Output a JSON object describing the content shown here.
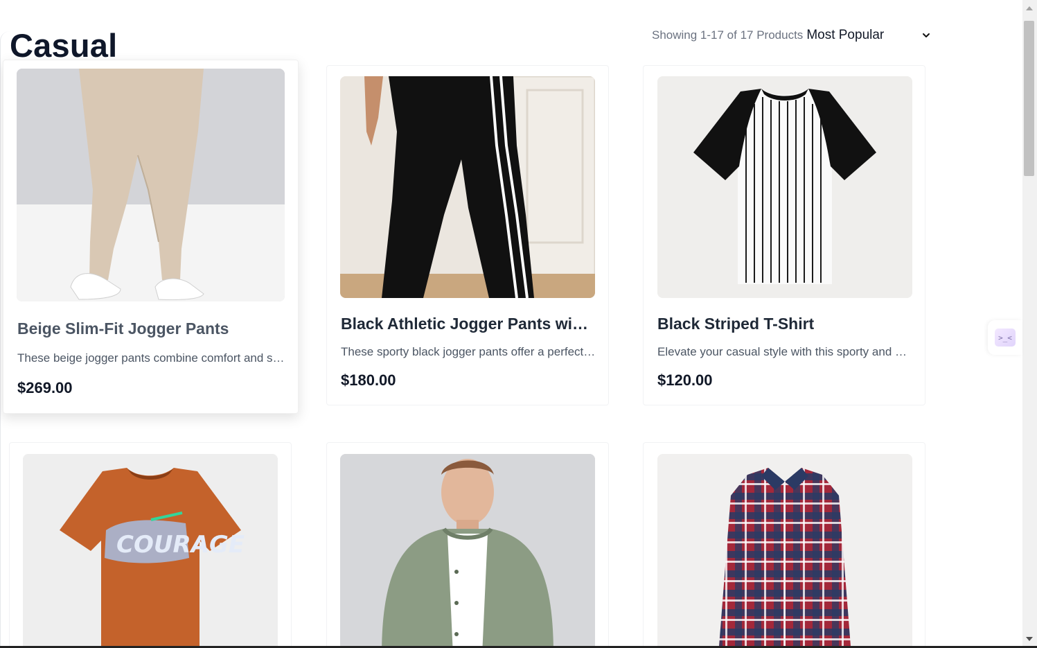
{
  "page": {
    "category_title": "Casual"
  },
  "toolbar": {
    "count_text": "Showing 1-17 of 17 Products",
    "sort_selected": "Most Popular"
  },
  "products": [
    {
      "name": "Beige Slim-Fit Jogger Pants",
      "description": "These beige jogger pants combine comfort and style",
      "price": "$269.00",
      "image": "beige-jogger-pants-photo"
    },
    {
      "name": "Black Athletic Jogger Pants with White Stripes",
      "description": "These sporty black jogger pants offer a perfect blend",
      "price": "$180.00",
      "image": "black-striped-jogger-pants-photo"
    },
    {
      "name": "Black Striped T-Shirt",
      "description": "Elevate your casual style with this sporty and classic",
      "price": "$120.00",
      "image": "black-striped-tshirt-photo"
    },
    {
      "name": "",
      "description": "",
      "price": "",
      "image": "orange-graphic-tshirt-photo"
    },
    {
      "name": "",
      "description": "",
      "price": "",
      "image": "olive-bomber-jacket-photo"
    },
    {
      "name": "",
      "description": "",
      "price": "",
      "image": "red-navy-plaid-shirt-photo"
    }
  ],
  "icons": {
    "sort_chevron": "chevron-down-icon",
    "side_widget": "code-assistant-icon"
  },
  "colors": {
    "title": "#0f172a",
    "price": "#111827",
    "muted_text": "#6b7280"
  }
}
